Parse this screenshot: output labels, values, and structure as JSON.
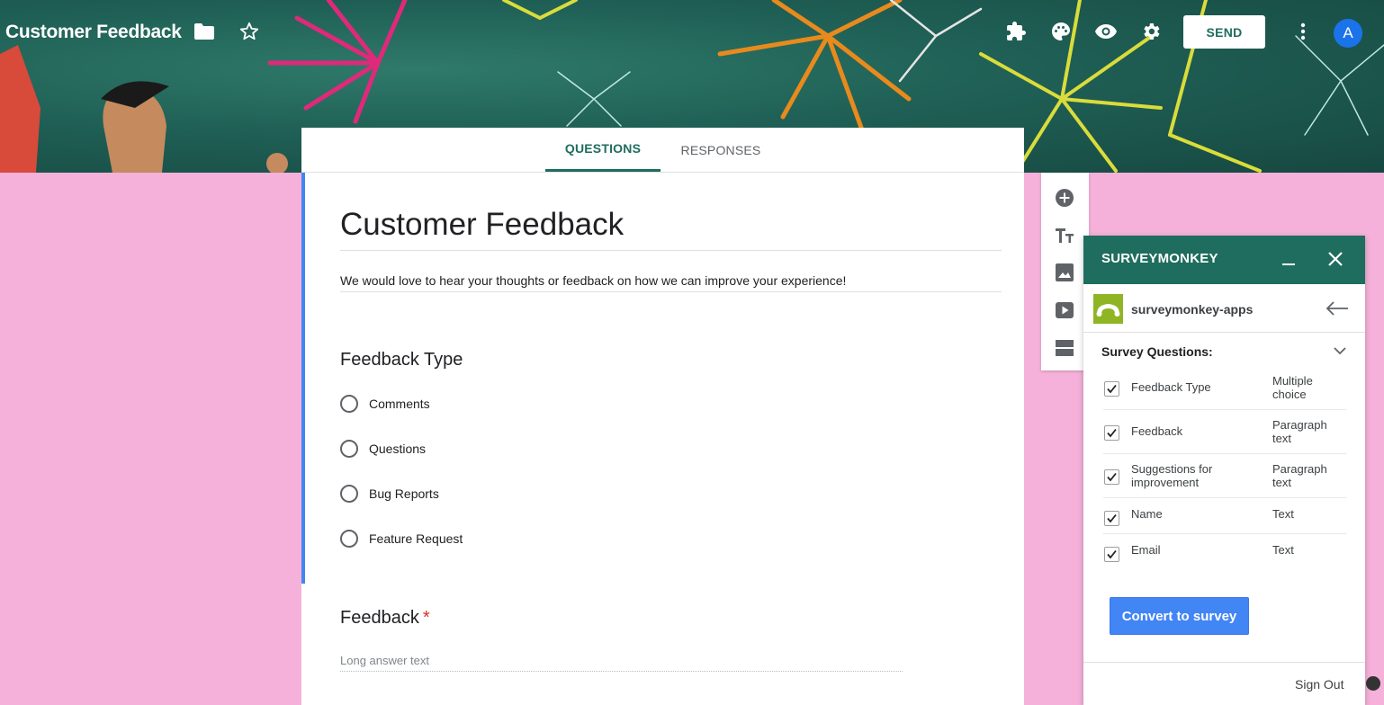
{
  "header": {
    "doc_title": "Customer Feedback",
    "send_label": "SEND",
    "avatar_letter": "A",
    "icons": [
      "folder-icon",
      "star-icon",
      "addons-icon",
      "palette-icon",
      "preview-eye-icon",
      "settings-gear-icon",
      "more-vert-icon"
    ]
  },
  "tabs": {
    "questions": "QUESTIONS",
    "responses": "RESPONSES"
  },
  "form": {
    "title": "Customer Feedback",
    "description": "We would love to hear your thoughts or feedback on how we can improve your experience!",
    "q1": {
      "title": "Feedback Type",
      "options": [
        "Comments",
        "Questions",
        "Bug Reports",
        "Feature Request"
      ]
    },
    "q2": {
      "title": "Feedback",
      "required_mark": "*",
      "hint": "Long answer text"
    }
  },
  "toolbar": {
    "icons": [
      "add-question-icon",
      "add-title-icon",
      "add-image-icon",
      "add-video-icon",
      "add-section-icon"
    ]
  },
  "surveymonkey": {
    "title": "SURVEYMONKEY",
    "app_name": "surveymonkey-apps",
    "list_heading": "Survey Questions:",
    "questions": [
      {
        "name": "Feedback Type",
        "type": "Multiple choice",
        "checked": true
      },
      {
        "name": "Feedback",
        "type": "Paragraph text",
        "checked": true
      },
      {
        "name": "Suggestions for improvement",
        "type": "Paragraph text",
        "checked": true
      },
      {
        "name": "Name",
        "type": "Text",
        "checked": true
      },
      {
        "name": "Email",
        "type": "Text",
        "checked": true
      }
    ],
    "convert_label": "Convert to survey",
    "signout_label": "Sign Out"
  },
  "colors": {
    "header_teal": "#1e6d5e",
    "background_pink": "#f5b1d9",
    "accent_blue": "#4285f4",
    "avatar_blue": "#1a73e8",
    "logo_green": "#8fb524"
  }
}
